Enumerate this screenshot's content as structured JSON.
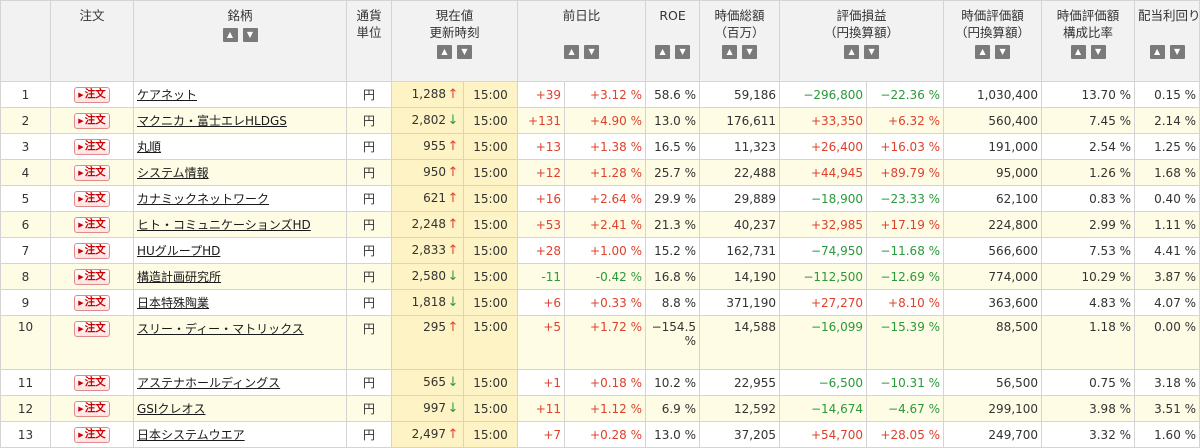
{
  "headers": {
    "order": "注文",
    "name": "銘柄",
    "currency": [
      "通貨",
      "単位"
    ],
    "price": [
      "現在値",
      "更新時刻"
    ],
    "change": "前日比",
    "roe": "ROE",
    "mcap": [
      "時価総額",
      "（百万）"
    ],
    "pnl": [
      "評価損益",
      "（円換算額）"
    ],
    "value": [
      "時価評価額",
      "（円換算額）"
    ],
    "ratio": [
      "時価評価額",
      "構成比率"
    ],
    "yield": "配当利回り"
  },
  "sort_icons": {
    "asc": "▲",
    "desc": "▼"
  },
  "order_label": "注文",
  "colors": {
    "up": "#e0402a",
    "down": "#2a9a3a",
    "highlight": "#fdf3c4",
    "alt_row": "#fffce6"
  },
  "rows": [
    {
      "no": "1",
      "name": "ケアネット",
      "cur": "円",
      "price": "1,288",
      "dir": "up",
      "arrow": "↑",
      "time": "15:00",
      "chg": "+39",
      "chgpct": "+3.12 %",
      "roe": "58.6 %",
      "mcap": "59,186",
      "pnl": "−296,800",
      "pnlpct": "−22.36 %",
      "pnlsign": "neg",
      "value": "1,030,400",
      "ratio": "13.70 %",
      "yield": "0.15 %"
    },
    {
      "no": "2",
      "name": "マクニカ・富士エレHLDGS",
      "cur": "円",
      "price": "2,802",
      "dir": "down",
      "arrow": "↓",
      "time": "15:00",
      "chg": "+131",
      "chgpct": "+4.90 %",
      "roe": "13.0 %",
      "mcap": "176,611",
      "pnl": "+33,350",
      "pnlpct": "+6.32 %",
      "pnlsign": "pos",
      "value": "560,400",
      "ratio": "7.45 %",
      "yield": "2.14 %"
    },
    {
      "no": "3",
      "name": "丸順",
      "cur": "円",
      "price": "955",
      "dir": "up",
      "arrow": "↑",
      "time": "15:00",
      "chg": "+13",
      "chgpct": "+1.38 %",
      "roe": "16.5 %",
      "mcap": "11,323",
      "pnl": "+26,400",
      "pnlpct": "+16.03 %",
      "pnlsign": "pos",
      "value": "191,000",
      "ratio": "2.54 %",
      "yield": "1.25 %"
    },
    {
      "no": "4",
      "name": "システム情報",
      "cur": "円",
      "price": "950",
      "dir": "up",
      "arrow": "↑",
      "time": "15:00",
      "chg": "+12",
      "chgpct": "+1.28 %",
      "roe": "25.7 %",
      "mcap": "22,488",
      "pnl": "+44,945",
      "pnlpct": "+89.79 %",
      "pnlsign": "pos",
      "value": "95,000",
      "ratio": "1.26 %",
      "yield": "1.68 %"
    },
    {
      "no": "5",
      "name": "カナミックネットワーク",
      "cur": "円",
      "price": "621",
      "dir": "up",
      "arrow": "↑",
      "time": "15:00",
      "chg": "+16",
      "chgpct": "+2.64 %",
      "roe": "29.9 %",
      "mcap": "29,889",
      "pnl": "−18,900",
      "pnlpct": "−23.33 %",
      "pnlsign": "neg",
      "value": "62,100",
      "ratio": "0.83 %",
      "yield": "0.40 %"
    },
    {
      "no": "6",
      "name": "ヒト・コミュニケーションズHD",
      "cur": "円",
      "price": "2,248",
      "dir": "up",
      "arrow": "↑",
      "time": "15:00",
      "chg": "+53",
      "chgpct": "+2.41 %",
      "roe": "21.3 %",
      "mcap": "40,237",
      "pnl": "+32,985",
      "pnlpct": "+17.19 %",
      "pnlsign": "pos",
      "value": "224,800",
      "ratio": "2.99 %",
      "yield": "1.11 %"
    },
    {
      "no": "7",
      "name": "HUグループHD",
      "cur": "円",
      "price": "2,833",
      "dir": "up",
      "arrow": "↑",
      "time": "15:00",
      "chg": "+28",
      "chgpct": "+1.00 %",
      "roe": "15.2 %",
      "mcap": "162,731",
      "pnl": "−74,950",
      "pnlpct": "−11.68 %",
      "pnlsign": "neg",
      "value": "566,600",
      "ratio": "7.53 %",
      "yield": "4.41 %"
    },
    {
      "no": "8",
      "name": "構造計画研究所",
      "cur": "円",
      "price": "2,580",
      "dir": "down",
      "arrow": "↓",
      "time": "15:00",
      "chg": "-11",
      "chgpct": "-0.42 %",
      "roe": "16.8 %",
      "mcap": "14,190",
      "pnl": "−112,500",
      "pnlpct": "−12.69 %",
      "pnlsign": "neg",
      "value": "774,000",
      "ratio": "10.29 %",
      "yield": "3.87 %"
    },
    {
      "no": "9",
      "name": "日本特殊陶業",
      "cur": "円",
      "price": "1,818",
      "dir": "down",
      "arrow": "↓",
      "time": "15:00",
      "chg": "+6",
      "chgpct": "+0.33 %",
      "roe": "8.8 %",
      "mcap": "371,190",
      "pnl": "+27,270",
      "pnlpct": "+8.10 %",
      "pnlsign": "pos",
      "value": "363,600",
      "ratio": "4.83 %",
      "yield": "4.07 %"
    },
    {
      "no": "10",
      "name": "スリー・ディー・マトリックス",
      "cur": "円",
      "price": "295",
      "dir": "up",
      "arrow": "↑",
      "time": "15:00",
      "chg": "+5",
      "chgpct": "+1.72 %",
      "roe": "−154.5",
      "roe2": "%",
      "mcap": "14,588",
      "pnl": "−16,099",
      "pnlpct": "−15.39 %",
      "pnlsign": "neg",
      "value": "88,500",
      "ratio": "1.18 %",
      "yield": "0.00 %"
    },
    {
      "no": "11",
      "name": "アステナホールディングス",
      "cur": "円",
      "price": "565",
      "dir": "down",
      "arrow": "↓",
      "time": "15:00",
      "chg": "+1",
      "chgpct": "+0.18 %",
      "roe": "10.2 %",
      "mcap": "22,955",
      "pnl": "−6,500",
      "pnlpct": "−10.31 %",
      "pnlsign": "neg",
      "value": "56,500",
      "ratio": "0.75 %",
      "yield": "3.18 %"
    },
    {
      "no": "12",
      "name": "GSIクレオス",
      "cur": "円",
      "price": "997",
      "dir": "down",
      "arrow": "↓",
      "time": "15:00",
      "chg": "+11",
      "chgpct": "+1.12 %",
      "roe": "6.9 %",
      "mcap": "12,592",
      "pnl": "−14,674",
      "pnlpct": "−4.67 %",
      "pnlsign": "neg",
      "value": "299,100",
      "ratio": "3.98 %",
      "yield": "3.51 %"
    },
    {
      "no": "13",
      "name": "日本システムウエア",
      "cur": "円",
      "price": "2,497",
      "dir": "up",
      "arrow": "↑",
      "time": "15:00",
      "chg": "+7",
      "chgpct": "+0.28 %",
      "roe": "13.0 %",
      "mcap": "37,205",
      "pnl": "+54,700",
      "pnlpct": "+28.05 %",
      "pnlsign": "pos",
      "value": "249,700",
      "ratio": "3.32 %",
      "yield": "1.60 %"
    }
  ]
}
